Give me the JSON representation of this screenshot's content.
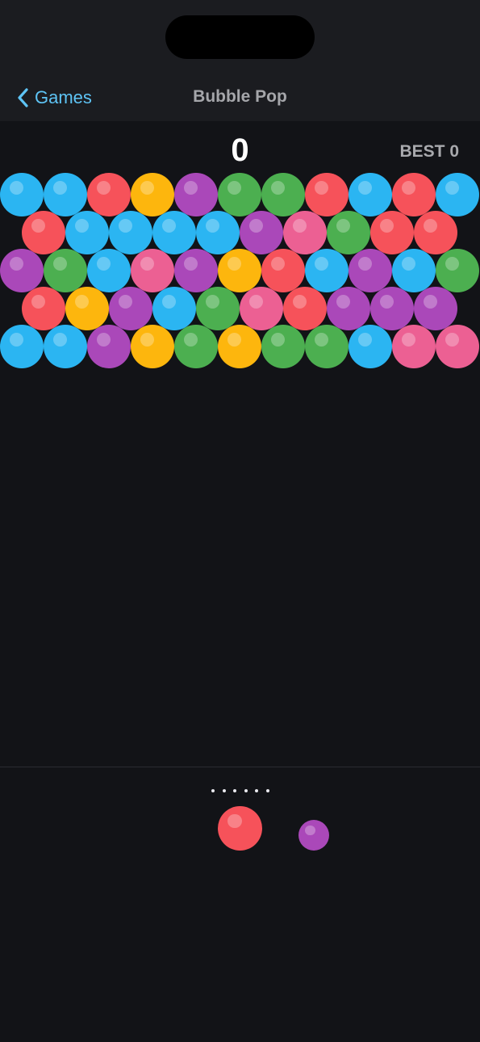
{
  "nav": {
    "back_label": "Games",
    "title": "Bubble Pop"
  },
  "score": {
    "value": "0",
    "best_label": "BEST",
    "best_value": "0"
  },
  "colors": {
    "blue": "#2bb5f2",
    "red": "#f6525a",
    "yellow": "#fdb60d",
    "purple": "#aa48b9",
    "green": "#4caf50",
    "pink": "#ec6093"
  },
  "board": {
    "rows": [
      [
        "blue",
        "blue",
        "red",
        "yellow",
        "purple",
        "green",
        "green",
        "red",
        "blue",
        "red",
        "blue"
      ],
      [
        "red",
        "blue",
        "blue",
        "blue",
        "blue",
        "purple",
        "pink",
        "green",
        "red",
        "red"
      ],
      [
        "purple",
        "green",
        "blue",
        "pink",
        "purple",
        "yellow",
        "red",
        "blue",
        "purple",
        "blue",
        "green"
      ],
      [
        "red",
        "yellow",
        "purple",
        "blue",
        "green",
        "pink",
        "red",
        "purple",
        "purple",
        "purple"
      ],
      [
        "blue",
        "blue",
        "purple",
        "yellow",
        "green",
        "yellow",
        "green",
        "green",
        "blue",
        "pink",
        "pink"
      ]
    ]
  },
  "shooter": {
    "aim_dots": 6,
    "current": "red",
    "next": "purple"
  }
}
